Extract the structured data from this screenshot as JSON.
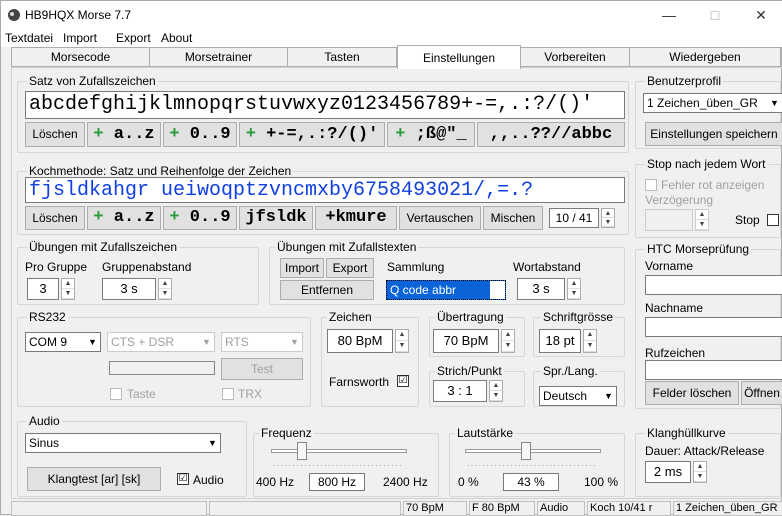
{
  "window": {
    "title": "HB9HQX Morse 7.7",
    "min": "—",
    "max": "□",
    "close": "✕"
  },
  "menu": [
    "Textdatei",
    "Import",
    "Export",
    "About"
  ],
  "tabs": [
    "Morsecode",
    "Morsetrainer",
    "Tasten",
    "Einstellungen",
    "Vorbereiten",
    "Wiedergeben"
  ],
  "satz": {
    "label": "Satz von Zufallszeichen",
    "text": "abcdefghijklmnopqrstuvwxyz0123456789+-=,.:?/()'",
    "clear": "Löschen",
    "b1": "a..z",
    "b2": "0..9",
    "b3": "+-=,.:?/()'",
    "b4": ";ß@\"_",
    "b5": ",,..??//abbc",
    "plus": "+"
  },
  "koch": {
    "label": "Kochmethode: Satz und Reihenfolge der Zeichen",
    "text": "fjsldkahgr  ueiwoqptzvncmxby6758493021/,=.?",
    "clear": "Löschen",
    "b1": "a..z",
    "b2": "0..9",
    "b3": "jfsldk",
    "b4": "+kmure",
    "swap": "Vertauschen",
    "mix": "Mischen",
    "count": "10 / 41",
    "plus": "+"
  },
  "zufall": {
    "label": "Übungen mit Zufallszeichen",
    "pro_label": "Pro Gruppe",
    "pro_val": "3",
    "abst_label": "Gruppenabstand",
    "abst_val": "3 s"
  },
  "texte": {
    "label": "Übungen mit Zufallstexten",
    "import": "Import",
    "export": "Export",
    "remove": "Entfernen",
    "samml_label": "Sammlung",
    "samml_val": "Q code abbr",
    "wort_label": "Wortabstand",
    "wort_val": "3 s"
  },
  "rs232": {
    "label": "RS232",
    "port": "COM 9",
    "sig1": "CTS + DSR",
    "sig2": "RTS",
    "test": "Test",
    "taste": "Taste",
    "trx": "TRX"
  },
  "zeichen": {
    "label": "Zeichen",
    "val": "80 BpM",
    "farns": "Farnsworth",
    "check": "☑"
  },
  "uebertragung": {
    "label": "Übertragung",
    "val": "70 BpM"
  },
  "schrift": {
    "label": "Schriftgrösse",
    "val": "18 pt"
  },
  "strich": {
    "label": "Strich/Punkt",
    "val": "3 : 1"
  },
  "sprache": {
    "label": "Spr./Lang.",
    "val": "Deutsch"
  },
  "audio": {
    "label": "Audio",
    "wave": "Sinus",
    "test": "Klangtest  [ar] [sk]",
    "chk_label": "Audio",
    "check": "☑"
  },
  "freq": {
    "label": "Frequenz",
    "min": "400 Hz",
    "val": "800 Hz",
    "max": "2400 Hz",
    "pos": 0.2
  },
  "laut": {
    "label": "Lautstärke",
    "min": "0 %",
    "val": "43 %",
    "max": "100 %",
    "pos": 0.43
  },
  "profil": {
    "label": "Benutzerprofil",
    "val": "1 Zeichen_üben_GR",
    "save": "Einstellungen speichern"
  },
  "stop": {
    "label": "Stop nach jedem Wort",
    "fehler": "Fehler rot anzeigen",
    "verz": "Verzögerung",
    "stop": "Stop"
  },
  "htc": {
    "label": "HTC Morseprüfung",
    "vorname": "Vorname",
    "name": "Nachname",
    "ruf": "Rufzeichen",
    "clear": "Felder löschen",
    "open": "Öffnen"
  },
  "klang": {
    "label": "Klanghüllkurve",
    "dauer": "Dauer: Attack/Release",
    "val": "2 ms"
  },
  "status": [
    "70 BpM",
    "F 80 BpM",
    "Audio",
    "Koch 10/41  r",
    "1 Zeichen_üben_GR"
  ]
}
